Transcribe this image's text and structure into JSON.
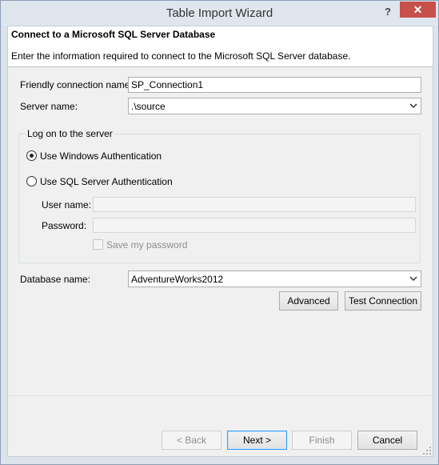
{
  "window": {
    "title": "Table Import Wizard",
    "help_label": "?",
    "close_label": "✕"
  },
  "header": {
    "title": "Connect to a Microsoft SQL Server Database",
    "description": "Enter the information required to connect to the Microsoft SQL Server database."
  },
  "form": {
    "friendly_name_label": "Friendly connection name:",
    "friendly_name_value": "SP_Connection1",
    "server_name_label": "Server name:",
    "server_name_value": ".\\source",
    "logon_group_label": "Log on to the server",
    "windows_auth_label": "Use Windows Authentication",
    "sql_auth_label": "Use SQL Server Authentication",
    "auth_selected": "windows",
    "username_label": "User name:",
    "username_value": "",
    "password_label": "Password:",
    "password_value": "",
    "save_password_label": "Save my password",
    "database_name_label": "Database name:",
    "database_name_value": "AdventureWorks2012",
    "advanced_label": "Advanced",
    "test_connection_label": "Test Connection"
  },
  "footer": {
    "back_label": "< Back",
    "next_label": "Next >",
    "finish_label": "Finish",
    "cancel_label": "Cancel"
  }
}
